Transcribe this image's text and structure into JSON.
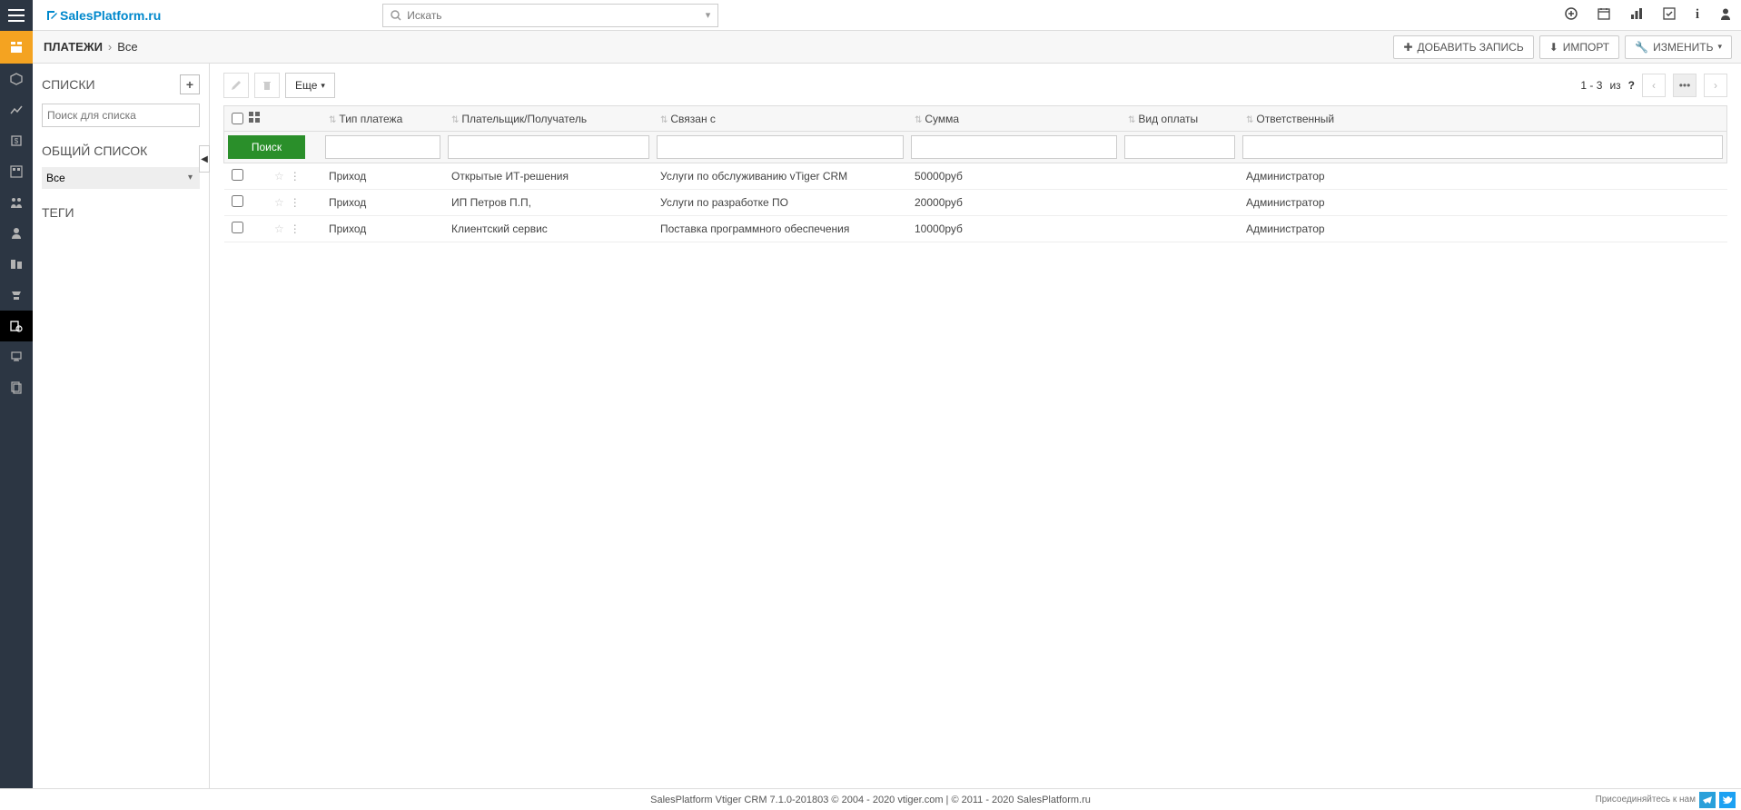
{
  "logo_text": "SalesPlatform.ru",
  "search_placeholder": "Искать",
  "top_buttons": {
    "add": "ДОБАВИТЬ ЗАПИСЬ",
    "import": "ИМПОРТ",
    "customize": "ИЗМЕНИТЬ"
  },
  "breadcrumb": {
    "module": "ПЛАТЕЖИ",
    "filter": "Все"
  },
  "left_panel": {
    "lists_header": "СПИСКИ",
    "list_search_placeholder": "Поиск для списка",
    "common_list_header": "ОБЩИЙ СПИСОК",
    "common_list_value": "Все",
    "tags_header": "ТЕГИ"
  },
  "toolbar": {
    "more_label": "Еще"
  },
  "pagination": {
    "range": "1 - 3",
    "of": "из",
    "total": "?"
  },
  "columns": {
    "type": "Тип платежа",
    "payer": "Плательщик/Получатель",
    "related": "Связан с",
    "amount": "Сумма",
    "pay_method": "Вид оплаты",
    "responsible": "Ответственный"
  },
  "search_button": "Поиск",
  "rows": [
    {
      "type": "Приход",
      "payer": "Открытые ИТ-решения",
      "related": "Услуги по обслуживанию vTiger CRM",
      "amount": "50000руб",
      "pay_method": "",
      "responsible": "Администратор"
    },
    {
      "type": "Приход",
      "payer": "ИП Петров П.П,",
      "related": "Услуги по разработке ПО",
      "amount": "20000руб",
      "pay_method": "",
      "responsible": "Администратор"
    },
    {
      "type": "Приход",
      "payer": "Клиентский сервис",
      "related": "Поставка программного обеспечения",
      "amount": "10000руб",
      "pay_method": "",
      "responsible": "Администратор"
    }
  ],
  "footer": {
    "text": "SalesPlatform Vtiger CRM 7.1.0-201803   © 2004 - 2020   vtiger.com   |   © 2011 - 2020  SalesPlatform.ru",
    "join": "Присоединяйтесь к нам"
  }
}
